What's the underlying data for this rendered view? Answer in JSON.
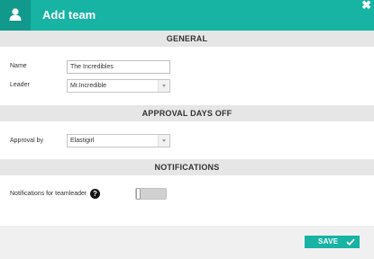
{
  "dialog": {
    "title": "Add team",
    "close_glyph": "✖",
    "header_icon": "user-icon",
    "accent_color": "#17b3a3"
  },
  "general": {
    "heading": "GENERAL",
    "name_label": "Name",
    "name_value": "The Incredibles",
    "leader_label": "Leader",
    "leader_value": "Mr.Incredible"
  },
  "approval": {
    "heading": "APPROVAL DAYS OFF",
    "approval_label": "Approval by",
    "approval_value": "Elastigirl"
  },
  "notifications": {
    "heading": "NOTIFICATIONS",
    "teamleader_label": "Notifications for teamleader",
    "help_glyph": "?",
    "toggle_on": false
  },
  "footer": {
    "save_label": "SAVE",
    "save_icon": "check-icon"
  }
}
